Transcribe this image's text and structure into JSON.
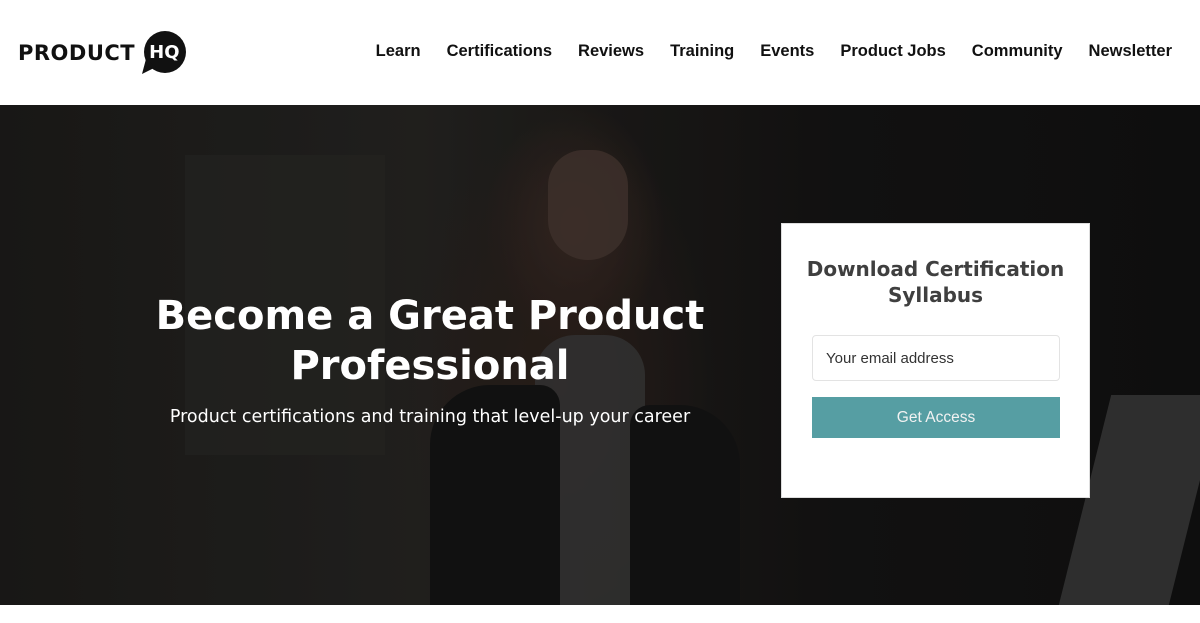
{
  "header": {
    "logo": {
      "text": "PRODUCT",
      "badge": "HQ",
      "icon": "speech-bubble-icon"
    },
    "nav": [
      {
        "label": "Learn"
      },
      {
        "label": "Certifications"
      },
      {
        "label": "Reviews"
      },
      {
        "label": "Training"
      },
      {
        "label": "Events"
      },
      {
        "label": "Product Jobs"
      },
      {
        "label": "Community"
      },
      {
        "label": "Newsletter"
      }
    ]
  },
  "hero": {
    "title": "Become a Great Product Professional",
    "subtitle": "Product certifications and training that level-up your career",
    "background_image": "woman-with-glasses-at-laptop-photo"
  },
  "signup_form": {
    "title": "Download Certification Syllabus",
    "email_placeholder": "Your email address",
    "email_value": "",
    "submit_label": "Get Access",
    "accent_color": "#569ea3"
  }
}
